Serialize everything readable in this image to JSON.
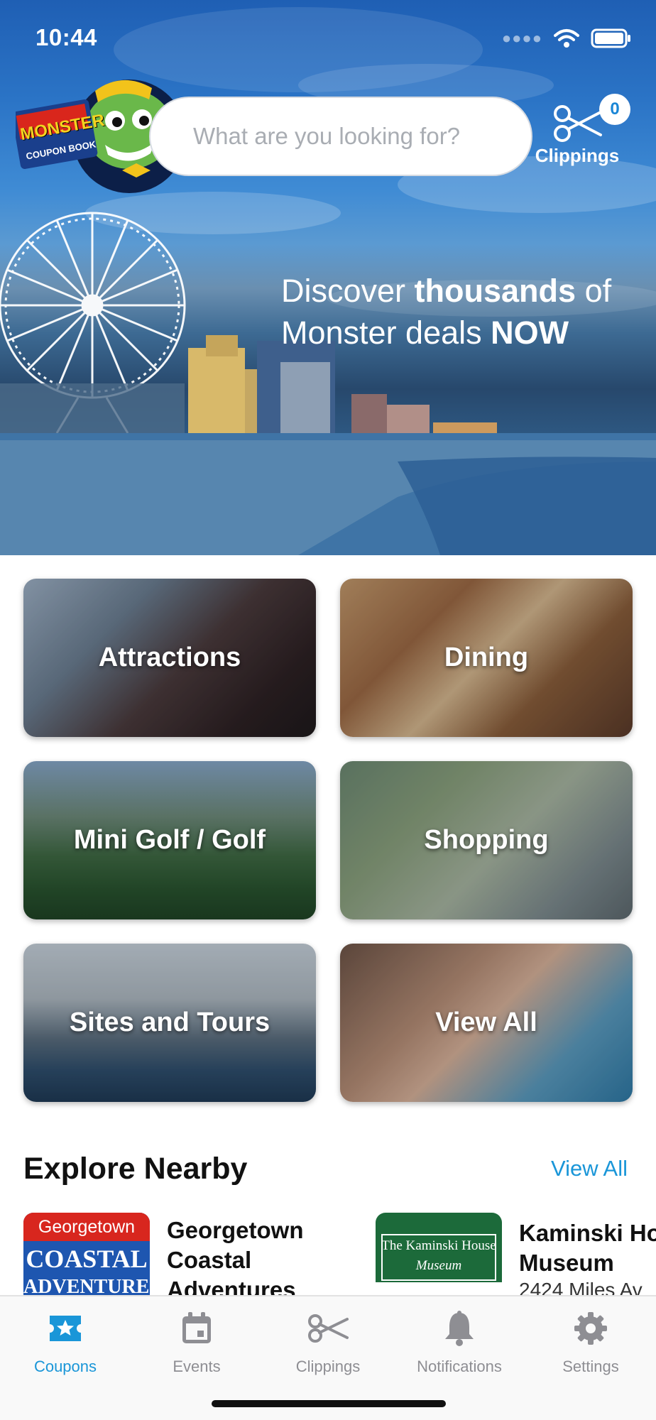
{
  "status_bar": {
    "time": "10:44"
  },
  "search": {
    "placeholder": "What are you looking for?"
  },
  "clippings": {
    "count": "0",
    "label": "Clippings"
  },
  "logo": {
    "text_top": "MONSTER",
    "text_bottom": "COUPON BOOK"
  },
  "hero": {
    "tagline_1": "Discover ",
    "tagline_bold_1": "thousands",
    "tagline_2": " of",
    "tagline_3": "Monster deals ",
    "tagline_bold_2": "NOW"
  },
  "categories": [
    {
      "label": "Attractions"
    },
    {
      "label": "Dining"
    },
    {
      "label": "Mini Golf / Golf"
    },
    {
      "label": "Shopping"
    },
    {
      "label": "Sites and Tours"
    },
    {
      "label": "View All"
    }
  ],
  "explore": {
    "title": "Explore Nearby",
    "view_all": "View All",
    "items": [
      {
        "name_1": "Georgetown",
        "name_2": "Coastal",
        "name_3": "Adventures",
        "logo_top": "Georgetown",
        "logo_main": "COASTAL",
        "logo_sub": "ADVENTURES"
      },
      {
        "name_1": "Kaminski House",
        "name_2": "Museum",
        "sub": "2424 Miles Av",
        "logo_main": "The Kaminski House",
        "logo_sub": "Museum"
      }
    ]
  },
  "tabbar": {
    "items": [
      {
        "label": "Coupons",
        "icon": "coupon-star-icon",
        "active": true
      },
      {
        "label": "Events",
        "icon": "calendar-icon",
        "active": false
      },
      {
        "label": "Clippings",
        "icon": "scissors-icon",
        "active": false
      },
      {
        "label": "Notifications",
        "icon": "bell-icon",
        "active": false
      },
      {
        "label": "Settings",
        "icon": "gear-icon",
        "active": false
      }
    ]
  },
  "colors": {
    "accent": "#1a96d8",
    "tab_inactive": "#8e8e93"
  }
}
